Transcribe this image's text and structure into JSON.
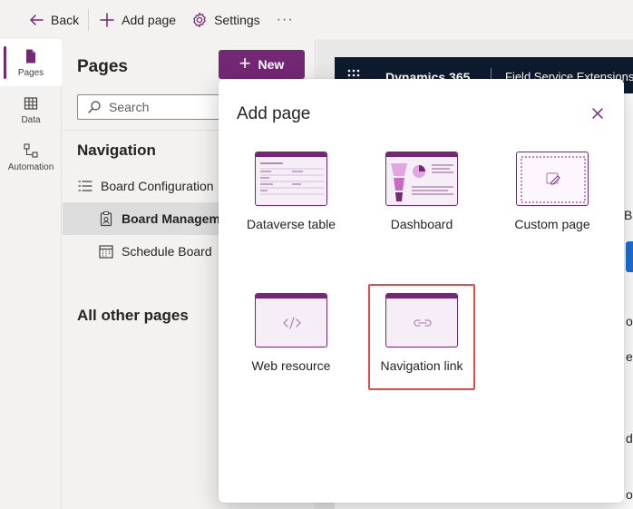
{
  "topbar": {
    "back_label": "Back",
    "add_page_label": "Add page",
    "settings_label": "Settings",
    "more_label": "···"
  },
  "rail": {
    "items": [
      {
        "label": "Pages",
        "icon": "page-icon",
        "active": true
      },
      {
        "label": "Data",
        "icon": "table-icon",
        "active": false
      },
      {
        "label": "Automation",
        "icon": "flow-icon",
        "active": false
      }
    ]
  },
  "panel": {
    "title": "Pages",
    "new_label": "New",
    "search_placeholder": "Search",
    "navigation_heading": "Navigation",
    "nav_items": [
      {
        "label": "Board Configuration",
        "icon": "list-icon"
      },
      {
        "label": "Board Managem",
        "icon": "clipboard-icon",
        "selected": true
      },
      {
        "label": "Schedule Board",
        "icon": "calendar-icon"
      }
    ],
    "other_heading": "All other pages"
  },
  "app": {
    "brand": "Dynamics 365",
    "app_name": "Field Service Extensions",
    "peek_texts": [
      "Bo",
      "o",
      "e",
      "d",
      "o"
    ]
  },
  "modal": {
    "title": "Add page",
    "options": [
      {
        "label": "Dataverse table",
        "icon": "table-form-icon"
      },
      {
        "label": "Dashboard",
        "icon": "dashboard-icon"
      },
      {
        "label": "Custom page",
        "icon": "custom-page-icon"
      },
      {
        "label": "Web resource",
        "icon": "code-icon"
      },
      {
        "label": "Navigation link",
        "icon": "link-icon",
        "highlighted": true
      }
    ]
  },
  "colors": {
    "accent": "#742774",
    "highlight": "#e04b4b",
    "app_header": "#0e1b2f"
  }
}
